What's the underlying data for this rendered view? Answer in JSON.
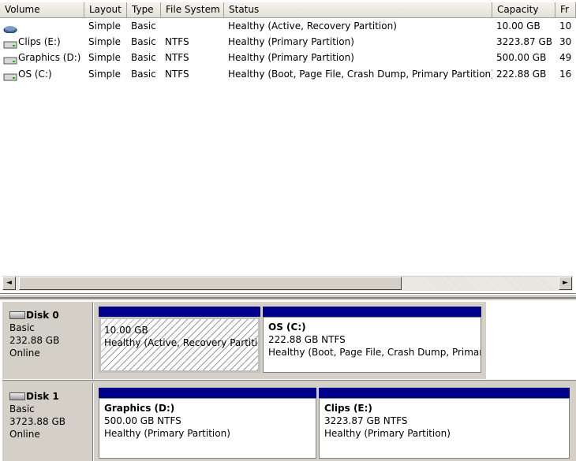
{
  "columns": [
    "Volume",
    "Layout",
    "Type",
    "File System",
    "Status",
    "Capacity",
    "Fr"
  ],
  "volumes": [
    {
      "name": "",
      "layout": "Simple",
      "type": "Basic",
      "fs": "",
      "status": "Healthy (Active, Recovery Partition)",
      "capacity": "10.00 GB",
      "free": "10",
      "icon": "blue-volume-icon"
    },
    {
      "name": "Clips (E:)",
      "layout": "Simple",
      "type": "Basic",
      "fs": "NTFS",
      "status": "Healthy (Primary Partition)",
      "capacity": "3223.87 GB",
      "free": "30",
      "icon": "drive-icon"
    },
    {
      "name": "Graphics (D:)",
      "layout": "Simple",
      "type": "Basic",
      "fs": "NTFS",
      "status": "Healthy (Primary Partition)",
      "capacity": "500.00 GB",
      "free": "49",
      "icon": "drive-icon"
    },
    {
      "name": "OS (C:)",
      "layout": "Simple",
      "type": "Basic",
      "fs": "NTFS",
      "status": "Healthy (Boot, Page File, Crash Dump, Primary Partition)",
      "capacity": "222.88 GB",
      "free": "16",
      "icon": "drive-icon"
    }
  ],
  "scrollbar": {
    "left_arrow": "◄",
    "right_arrow": "►"
  },
  "disks": [
    {
      "name": "Disk 0",
      "type": "Basic",
      "size": "232.88 GB",
      "status": "Online",
      "partitions": [
        {
          "title": "",
          "line1": "10.00 GB",
          "line2": "Healthy (Active, Recovery Partition)",
          "selected": true
        },
        {
          "title": "OS  (C:)",
          "line1": "222.88 GB NTFS",
          "line2": "Healthy (Boot, Page File, Crash Dump, Primary Partition)",
          "selected": false
        }
      ]
    },
    {
      "name": "Disk 1",
      "type": "Basic",
      "size": "3723.88 GB",
      "status": "Online",
      "partitions": [
        {
          "title": "Graphics  (D:)",
          "line1": "500.00 GB NTFS",
          "line2": "Healthy (Primary Partition)",
          "selected": false
        },
        {
          "title": "Clips  (E:)",
          "line1": "3223.87 GB NTFS",
          "line2": "Healthy (Primary Partition)",
          "selected": false
        }
      ]
    }
  ],
  "colors": {
    "partition_bar": "#00008b",
    "pane_bg": "#d4d0c8"
  }
}
